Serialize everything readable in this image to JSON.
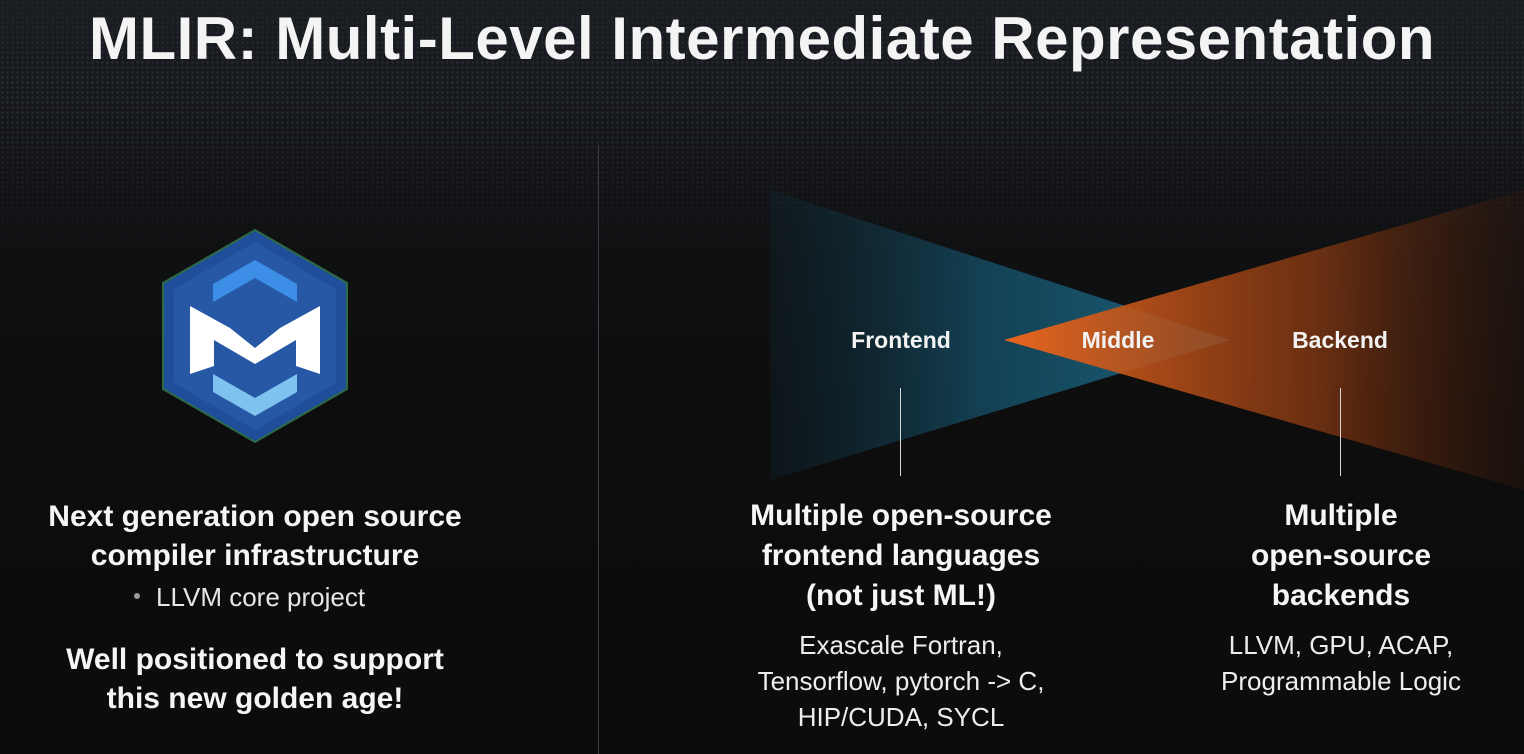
{
  "title": "MLIR: Multi-Level Intermediate Representation",
  "left": {
    "heading_lines": [
      "Next generation open source",
      "compiler infrastructure"
    ],
    "bullet": "LLVM core project",
    "closing_lines": [
      "Well positioned to support",
      "this new golden age!"
    ]
  },
  "diagram": {
    "frontend_label": "Frontend",
    "middle_label": "Middle",
    "backend_label": "Backend",
    "frontend_color": "#1b5f7c",
    "backend_color": "#e0621f"
  },
  "frontend_column": {
    "heading_lines": [
      "Multiple open-source",
      "frontend languages",
      "(not just ML!)"
    ],
    "body_lines": [
      "Exascale Fortran,",
      "Tensorflow, pytorch -> C,",
      "HIP/CUDA, SYCL"
    ]
  },
  "backend_column": {
    "heading_lines": [
      "Multiple",
      "open-source",
      "backends"
    ],
    "body_lines": [
      "LLVM, GPU, ACAP,",
      "Programmable Logic"
    ]
  },
  "logo": {
    "icon": "mlir-logo-icon",
    "colors": {
      "hex_outer": "#1f4f9a",
      "hex_inner": "#2a63b3",
      "letter": "#ffffff",
      "top_chevron": "#3d8ee6",
      "bottom_chevron": "#7ec3ef"
    }
  }
}
